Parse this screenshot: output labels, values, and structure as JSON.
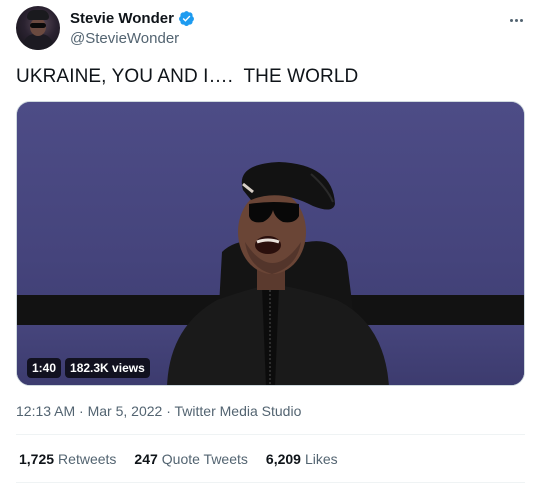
{
  "author": {
    "display_name": "Stevie Wonder",
    "handle": "@StevieWonder",
    "verified": true,
    "avatar_icon": "avatar-photo"
  },
  "more_icon": "more-horizontal-icon",
  "tweet": {
    "text": "UKRAINE, YOU AND I….  THE WORLD"
  },
  "media": {
    "type": "video",
    "duration": "1:40",
    "views": "182.3K views"
  },
  "meta": {
    "time": "12:13 AM",
    "separator1": " · ",
    "date": "Mar 5, 2022",
    "separator2": " · ",
    "source": "Twitter Media Studio"
  },
  "stats": {
    "retweets": {
      "count": "1,725",
      "label": "Retweets"
    },
    "quotes": {
      "count": "247",
      "label": "Quote Tweets"
    },
    "likes": {
      "count": "6,209",
      "label": "Likes"
    }
  },
  "colors": {
    "accent": "#1d9bf0",
    "secondary_text": "#536471",
    "primary_text": "#0f1419"
  }
}
